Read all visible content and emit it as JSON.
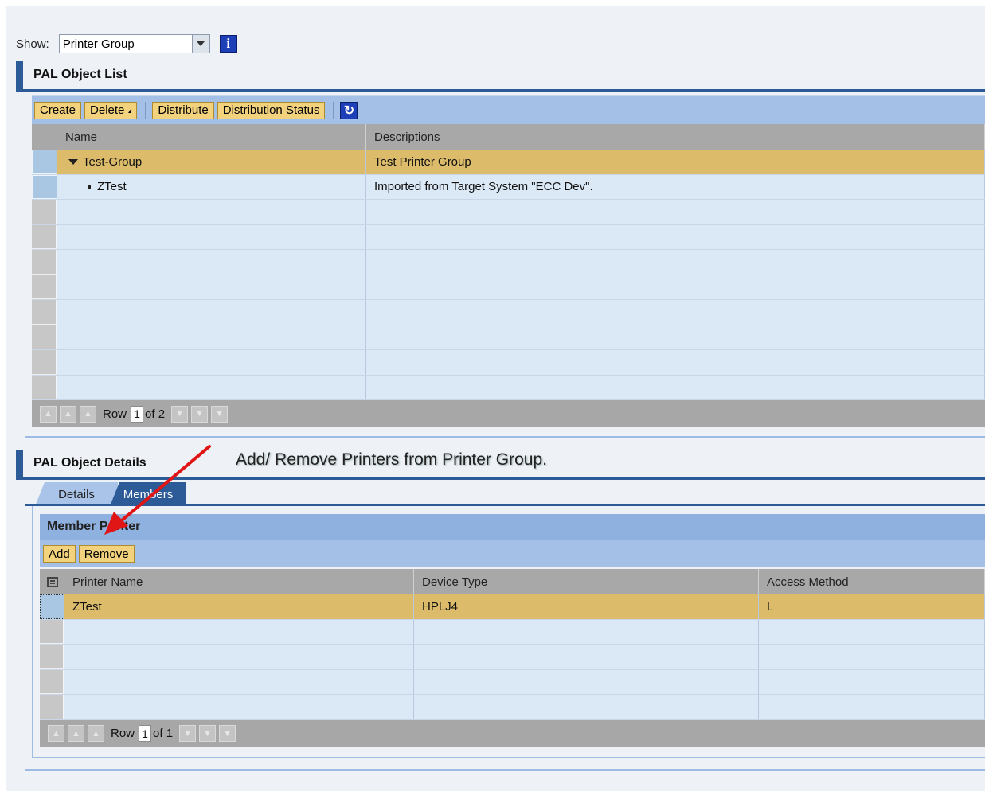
{
  "show": {
    "label": "Show:",
    "value": "Printer Group"
  },
  "object_list": {
    "title": "PAL Object List",
    "toolbar": {
      "create": "Create",
      "delete": "Delete",
      "distribute": "Distribute",
      "distribution_status": "Distribution Status"
    },
    "columns": [
      "Name",
      "Descriptions"
    ],
    "rows": [
      {
        "name": "Test-Group",
        "description": "Test Printer Group",
        "selected": true,
        "expanded": true
      },
      {
        "name": "ZTest",
        "description": "Imported from Target System \"ECC Dev\".",
        "selected": false
      }
    ],
    "pager": {
      "row_label": "Row",
      "current": "1",
      "of_label": "of 2"
    }
  },
  "details": {
    "title": "PAL Object Details",
    "annotation": "Add/ Remove Printers from Printer Group.",
    "tabs": [
      {
        "label": "Details",
        "active": false
      },
      {
        "label": "Members",
        "active": true
      }
    ],
    "panel_title": "Member Printer",
    "toolbar": {
      "add": "Add",
      "remove": "Remove"
    },
    "columns": [
      "Printer Name",
      "Device Type",
      "Access Method"
    ],
    "rows": [
      {
        "printer_name": "ZTest",
        "device_type": "HPLJ4",
        "access_method": "L"
      }
    ],
    "pager": {
      "row_label": "Row",
      "current": "1",
      "of_label": "of 1"
    }
  },
  "icons": {
    "info": "info-icon",
    "refresh": "refresh-icon",
    "settings": "table-settings-icon",
    "dropdown": "chevron-down-icon"
  },
  "colors": {
    "accent": "#2d5b98",
    "selected_row": "#dcbc6b",
    "button": "#f2d27c",
    "arrow": "#e01515"
  }
}
